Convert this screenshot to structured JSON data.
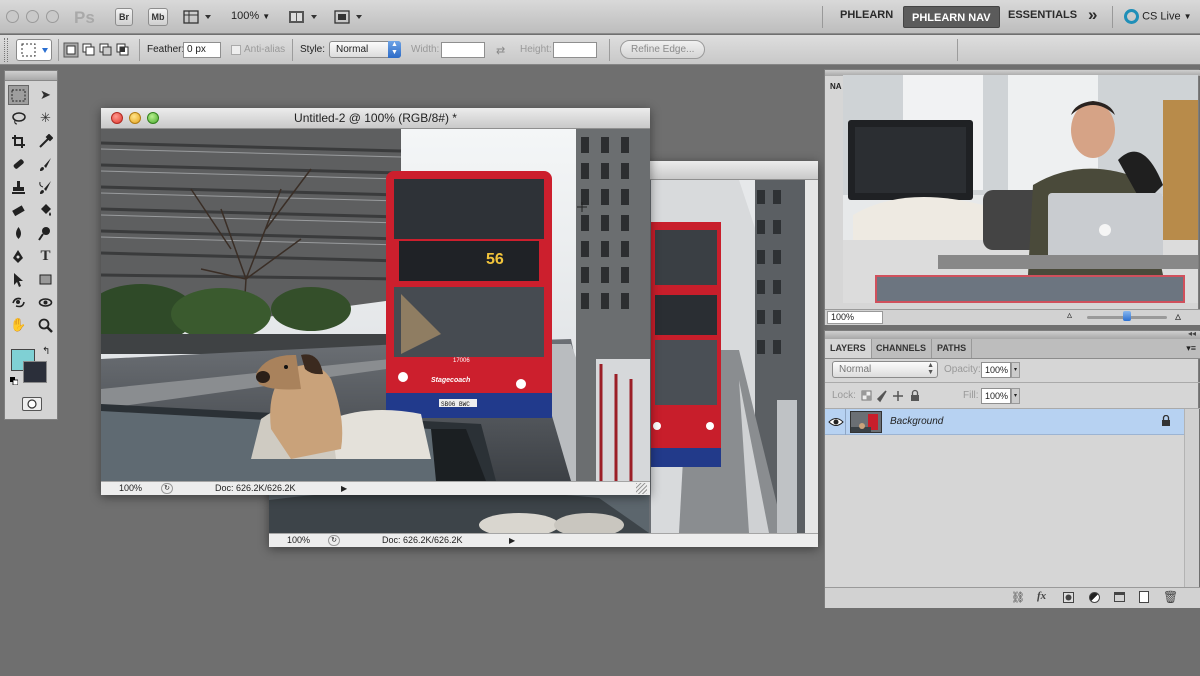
{
  "app": {
    "logo": "Ps",
    "bridge_label": "Br",
    "minibridge_label": "Mb",
    "zoom": "100%",
    "workspaces": [
      "PHLEARN",
      "PHLEARN NAV",
      "ESSENTIALS"
    ],
    "more": "»",
    "cslive": "CS Live"
  },
  "options": {
    "feather_label": "Feather:",
    "feather_value": "0 px",
    "antialias_label": "Anti-alias",
    "style_label": "Style:",
    "style_value": "Normal",
    "width_label": "Width:",
    "height_label": "Height:",
    "refine_label": "Refine Edge..."
  },
  "colors": {
    "foreground": "#7fd0d4",
    "background": "#2b2f3a",
    "accent": "#2b6fd1",
    "layer_selected": "#b7d2f2"
  },
  "tools": [
    "rect-marquee",
    "move",
    "lasso",
    "magic-wand",
    "crop",
    "eyedropper",
    "healing",
    "brush",
    "stamp",
    "history-brush",
    "eraser",
    "paint-bucket",
    "blur",
    "dodge",
    "pen",
    "type",
    "path-select",
    "shape",
    "3d-rotate",
    "3d-orbit",
    "hand",
    "zoom"
  ],
  "doc_front": {
    "title": "Untitled-2 @ 100% (RGB/8#) *",
    "zoom": "100%",
    "doc_info": "Doc: 626.2K/626.2K",
    "bus_route": "56",
    "bus_brand": "Stagecoach",
    "bus_plate": "SB06 BWC",
    "bus_fleet": "17006"
  },
  "doc_back": {
    "zoom": "100%",
    "doc_info": "Doc: 626.2K/626.2K"
  },
  "navigator": {
    "tab": "NA",
    "zoom": "100%",
    "zoom_level": 0.5
  },
  "layers_panel": {
    "tabs": [
      "LAYERS",
      "CHANNELS",
      "PATHS"
    ],
    "blend_mode": "Normal",
    "opacity_label": "Opacity:",
    "opacity_value": "100%",
    "lock_label": "Lock:",
    "fill_label": "Fill:",
    "fill_value": "100%",
    "layers": [
      {
        "name": "Background",
        "visible": true,
        "locked": true
      }
    ]
  }
}
